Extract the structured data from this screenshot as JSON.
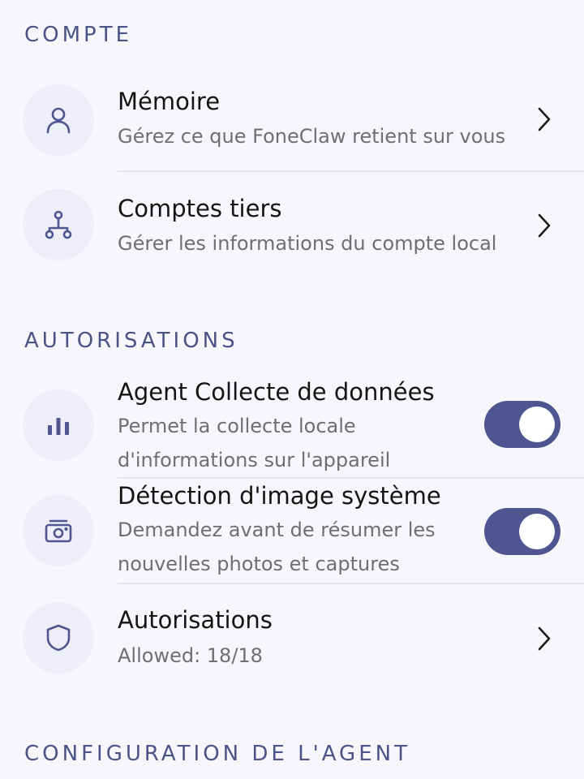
{
  "sections": {
    "compte": {
      "title": "COMPTE",
      "items": [
        {
          "icon": "person-icon",
          "title": "Mémoire",
          "subtitle": "Gérez ce que FoneClaw retient sur vous",
          "control": "chevron"
        },
        {
          "icon": "network-tree-icon",
          "title": "Comptes tiers",
          "subtitle": "Gérer les informations du compte local",
          "control": "chevron"
        }
      ]
    },
    "autorisations": {
      "title": "AUTORISATIONS",
      "items": [
        {
          "icon": "bar-chart-icon",
          "title": "Agent Collecte de données",
          "subtitle": "Permet la collecte locale d'informations sur l'appareil",
          "control": "toggle",
          "enabled": true
        },
        {
          "icon": "camera-icon",
          "title": "Détection d'image système",
          "subtitle": "Demandez avant de résumer les nouvelles photos et captures",
          "control": "toggle",
          "enabled": true
        },
        {
          "icon": "shield-icon",
          "title": "Autorisations",
          "subtitle": "Allowed: 18/18",
          "control": "chevron"
        }
      ]
    },
    "configuration": {
      "title": "CONFIGURATION DE L'AGENT"
    }
  },
  "colors": {
    "background": "#f7f6fb",
    "accent": "#4d5690",
    "section_title": "#4a5486",
    "icon_bg": "#eeeef8"
  }
}
